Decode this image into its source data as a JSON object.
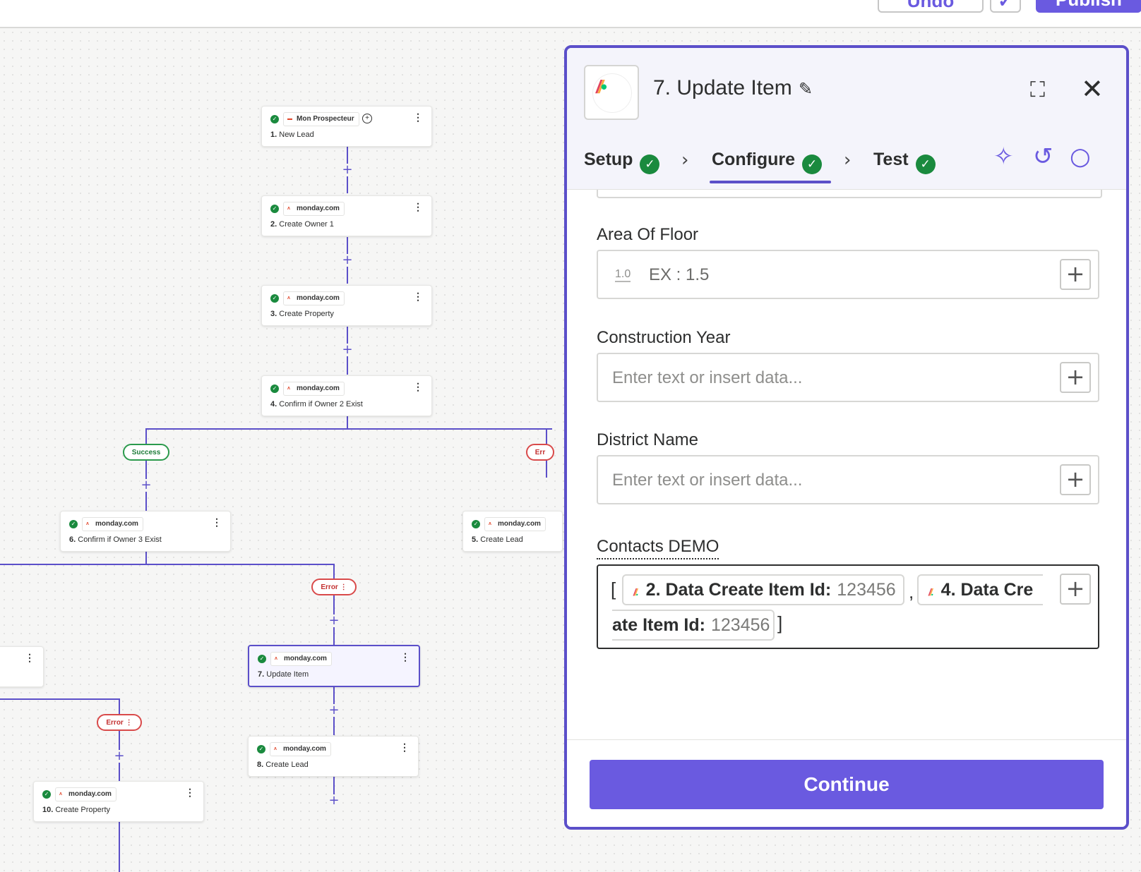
{
  "topbar": {
    "undo_label": "Undo",
    "check_label": "✓",
    "publish_label": "Publish"
  },
  "nodes": [
    {
      "app": "Mon Prospecteur",
      "num": "1.",
      "title": "New Lead"
    },
    {
      "app": "monday.com",
      "num": "2.",
      "title": "Create Owner 1"
    },
    {
      "app": "monday.com",
      "num": "3.",
      "title": "Create Property"
    },
    {
      "app": "monday.com",
      "num": "4.",
      "title": "Confirm if Owner 2 Exist"
    },
    {
      "app": "monday.com",
      "num": "6.",
      "title": "Confirm if Owner 3 Exist"
    },
    {
      "app": "monday.com",
      "num": "5.",
      "title": "Create Lead"
    },
    {
      "app": "monday.com",
      "num": "7.",
      "title": "Update Item"
    },
    {
      "app": "monday.com",
      "num": "8.",
      "title": "Create Lead"
    },
    {
      "app": "monday.com",
      "num": "10.",
      "title": "Create Property"
    }
  ],
  "badges": {
    "success": "Success",
    "error": "Error",
    "error_partial": "Err"
  },
  "panel": {
    "title": "7. Update Item",
    "tabs": {
      "setup": "Setup",
      "configure": "Configure",
      "test": "Test"
    },
    "fields": {
      "area_label": "Area Of Floor",
      "area_num_icon": "1.0",
      "area_placeholder": "EX : 1.5",
      "construction_label": "Construction Year",
      "construction_placeholder": "Enter text or insert data...",
      "district_label": "District Name",
      "district_placeholder": "Enter text or insert data...",
      "contacts_label": "Contacts DEMO",
      "contacts": {
        "open": "[",
        "comma": ",",
        "close": "]",
        "pill1_label": "2. Data Create Item Id:",
        "pill1_value": "123456",
        "pill2_label": "4. Data Cre",
        "pill2_cont_label": "ate Item Id:",
        "pill2_value": "123456"
      }
    },
    "continue_label": "Continue"
  },
  "colors": {
    "accent": "#6a5ae0",
    "success": "#1a8a3e",
    "error": "#d94a4a"
  }
}
